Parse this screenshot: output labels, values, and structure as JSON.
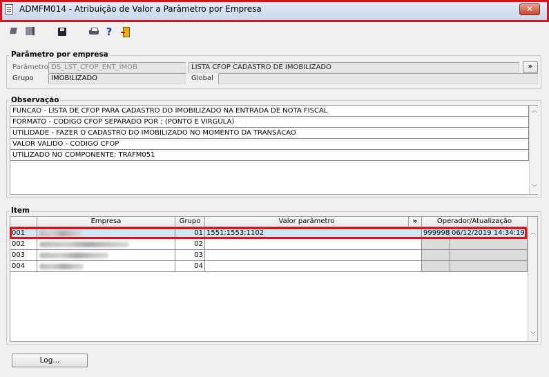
{
  "window": {
    "title": "ADMFM014 - Atribuição de Valor a Parâmetro por Empresa",
    "close_glyph": "✕"
  },
  "toolbar": {
    "help_glyph": "?",
    "icons": [
      "select-icon",
      "multi-select-icon",
      "save-icon",
      "print-icon",
      "help-icon",
      "exit-door-icon"
    ]
  },
  "parametro_group": {
    "legend": "Parâmetro por empresa",
    "parametro_label": "Parâmetro",
    "parametro_code": "DS_LST_CFOP_ENT_IMOB",
    "parametro_desc": "LISTA CFOP CADASTRO DE IMOBILIZADO",
    "more_button": "»",
    "grupo_label": "Grupo",
    "grupo_value": "IMOBILIZADO",
    "global_label": "Global",
    "global_value": ""
  },
  "observacao": {
    "legend": "Observação",
    "lines": [
      "FUNCAO - LISTA DE CFOP PARA CADASTRO DO IMOBILIZADO NA ENTRADA DE NOTA FISCAL",
      "FORMATO - CODIGO CFOP SEPARADO POR ; (PONTO E VIRGULA)",
      "UTILIDADE - FAZER O CADASTRO DO IMOBILIZADO NO MOMENTO DA TRANSACAO",
      "VALOR VALIDO - CODIGO CFOP",
      "UTILIZADO NO COMPONENTE: TRAFM051"
    ]
  },
  "item": {
    "legend": "Item",
    "columns": {
      "empresa": "Empresa",
      "grupo": "Grupo",
      "valor": "Valor parâmetro",
      "expand": "»",
      "operador": "Operador/Atualização"
    },
    "rows": [
      {
        "code": "001",
        "grupo": "01",
        "valor": "1551;1553;1102",
        "operador": "999998",
        "atualizacao": "06/12/2019 14:34:19"
      },
      {
        "code": "002",
        "grupo": "02",
        "valor": "",
        "operador": "",
        "atualizacao": ""
      },
      {
        "code": "003",
        "grupo": "03",
        "valor": "",
        "operador": "",
        "atualizacao": ""
      },
      {
        "code": "004",
        "grupo": "04",
        "valor": "",
        "operador": "",
        "atualizacao": ""
      }
    ]
  },
  "footer": {
    "log_button": "Log..."
  },
  "scroll": {
    "up": "︿",
    "down": "﹀"
  },
  "colors": {
    "highlight_border": "#e0101a",
    "selected_row": "#cfe8f5"
  }
}
